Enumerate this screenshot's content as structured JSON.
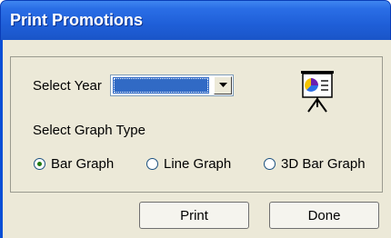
{
  "window": {
    "title": "Print Promotions"
  },
  "form": {
    "select_year_label": "Select Year",
    "select_year_value": "",
    "select_graph_type_label": "Select Graph Type",
    "graph_types": [
      {
        "label": "Bar Graph",
        "checked": true
      },
      {
        "label": "Line Graph",
        "checked": false
      },
      {
        "label": "3D Bar Graph",
        "checked": false
      }
    ]
  },
  "buttons": {
    "print_label": "Print",
    "done_label": "Done"
  },
  "icons": {
    "easel": "presentation-chart-icon",
    "dropdown": "chevron-down-icon"
  },
  "colors": {
    "titlebar": "#1f5fd8",
    "selection": "#316ac5",
    "dialog_bg": "#ece9d8"
  }
}
